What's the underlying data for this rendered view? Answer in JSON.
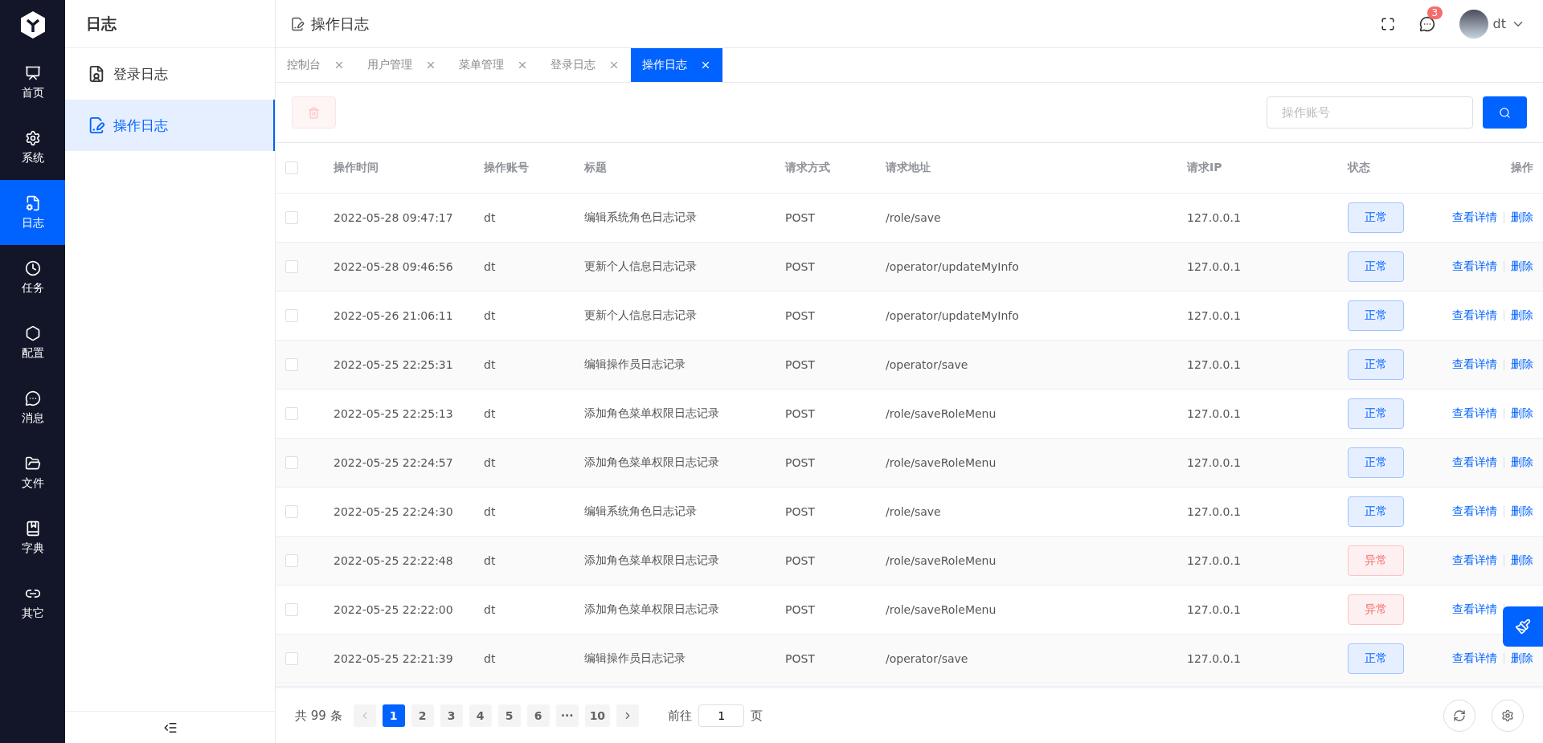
{
  "rail": {
    "items": [
      {
        "label": "首页",
        "selected": false
      },
      {
        "label": "系统",
        "selected": false
      },
      {
        "label": "日志",
        "selected": true
      },
      {
        "label": "任务",
        "selected": false
      },
      {
        "label": "配置",
        "selected": false
      },
      {
        "label": "消息",
        "selected": false
      },
      {
        "label": "文件",
        "selected": false
      },
      {
        "label": "字典",
        "selected": false
      },
      {
        "label": "其它",
        "selected": false
      }
    ]
  },
  "submenu": {
    "title": "日志",
    "items": [
      {
        "label": "登录日志",
        "selected": false
      },
      {
        "label": "操作日志",
        "selected": true
      }
    ]
  },
  "header": {
    "title": "操作日志",
    "notification_count": "3",
    "user": "dt"
  },
  "tabs": [
    {
      "label": "控制台",
      "selected": false
    },
    {
      "label": "用户管理",
      "selected": false
    },
    {
      "label": "菜单管理",
      "selected": false
    },
    {
      "label": "登录日志",
      "selected": false
    },
    {
      "label": "操作日志",
      "selected": true
    }
  ],
  "toolbar": {
    "delete_disabled": true,
    "search": {
      "placeholder": "操作账号"
    }
  },
  "table": {
    "select_all_checked": false,
    "columns": [
      "操作时间",
      "操作账号",
      "标题",
      "请求方式",
      "请求地址",
      "请求IP",
      "状态",
      "操作"
    ],
    "rows": [
      {
        "kind": "ok",
        "checked": false,
        "time": "2022-05-28 09:47:17",
        "account": "dt",
        "title": "编辑系统角色日志记录",
        "method": "POST",
        "url": "/role/save",
        "ip": "127.0.0.1",
        "status": "正常",
        "actions": [
          "查看详情",
          "删除"
        ]
      },
      {
        "kind": "ok",
        "checked": false,
        "time": "2022-05-28 09:46:56",
        "account": "dt",
        "title": "更新个人信息日志记录",
        "method": "POST",
        "url": "/operator/updateMyInfo",
        "ip": "127.0.0.1",
        "status": "正常",
        "actions": [
          "查看详情",
          "删除"
        ]
      },
      {
        "kind": "ok",
        "checked": false,
        "time": "2022-05-26 21:06:11",
        "account": "dt",
        "title": "更新个人信息日志记录",
        "method": "POST",
        "url": "/operator/updateMyInfo",
        "ip": "127.0.0.1",
        "status": "正常",
        "actions": [
          "查看详情",
          "删除"
        ]
      },
      {
        "kind": "ok",
        "checked": false,
        "time": "2022-05-25 22:25:31",
        "account": "dt",
        "title": "编辑操作员日志记录",
        "method": "POST",
        "url": "/operator/save",
        "ip": "127.0.0.1",
        "status": "正常",
        "actions": [
          "查看详情",
          "删除"
        ]
      },
      {
        "kind": "ok",
        "checked": false,
        "time": "2022-05-25 22:25:13",
        "account": "dt",
        "title": "添加角色菜单权限日志记录",
        "method": "POST",
        "url": "/role/saveRoleMenu",
        "ip": "127.0.0.1",
        "status": "正常",
        "actions": [
          "查看详情",
          "删除"
        ]
      },
      {
        "kind": "ok",
        "checked": false,
        "time": "2022-05-25 22:24:57",
        "account": "dt",
        "title": "添加角色菜单权限日志记录",
        "method": "POST",
        "url": "/role/saveRoleMenu",
        "ip": "127.0.0.1",
        "status": "正常",
        "actions": [
          "查看详情",
          "删除"
        ]
      },
      {
        "kind": "ok",
        "checked": false,
        "time": "2022-05-25 22:24:30",
        "account": "dt",
        "title": "编辑系统角色日志记录",
        "method": "POST",
        "url": "/role/save",
        "ip": "127.0.0.1",
        "status": "正常",
        "actions": [
          "查看详情",
          "删除"
        ]
      },
      {
        "kind": "error",
        "checked": false,
        "time": "2022-05-25 22:22:48",
        "account": "dt",
        "title": "添加角色菜单权限日志记录",
        "method": "POST",
        "url": "/role/saveRoleMenu",
        "ip": "127.0.0.1",
        "status": "异常",
        "actions": [
          "查看详情",
          "删除"
        ]
      },
      {
        "kind": "error",
        "checked": false,
        "time": "2022-05-25 22:22:00",
        "account": "dt",
        "title": "添加角色菜单权限日志记录",
        "method": "POST",
        "url": "/role/saveRoleMenu",
        "ip": "127.0.0.1",
        "status": "异常",
        "actions": [
          "查看详情"
        ]
      },
      {
        "kind": "ok",
        "checked": false,
        "time": "2022-05-25 22:21:39",
        "account": "dt",
        "title": "编辑操作员日志记录",
        "method": "POST",
        "url": "/operator/save",
        "ip": "127.0.0.1",
        "status": "正常",
        "actions": [
          "查看详情",
          "删除"
        ]
      }
    ]
  },
  "pagination": {
    "total": "共 99 条",
    "pages": [
      {
        "label": "1",
        "selected": true
      },
      {
        "label": "2",
        "selected": false
      },
      {
        "label": "3",
        "selected": false
      },
      {
        "label": "4",
        "selected": false
      },
      {
        "label": "5",
        "selected": false
      },
      {
        "label": "6",
        "selected": false
      },
      {
        "label": "···",
        "selected": false
      },
      {
        "label": "10",
        "selected": false
      }
    ],
    "goto_label": "前往",
    "goto_value": "1",
    "page_unit": "页"
  }
}
